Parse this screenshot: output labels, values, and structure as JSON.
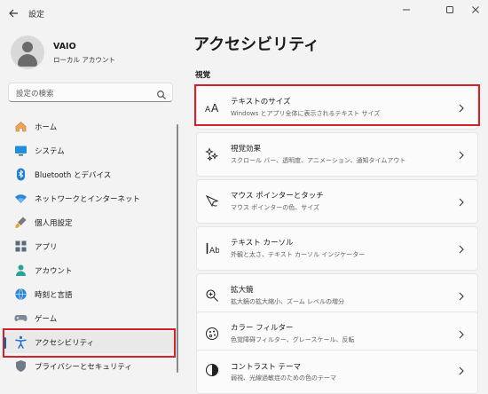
{
  "window": {
    "title": "設定",
    "back_icon": "back-arrow-icon",
    "controls": [
      "minimize-icon",
      "maximize-icon",
      "close-icon"
    ]
  },
  "profile": {
    "name": "VAIO",
    "account_type": "ローカル アカウント"
  },
  "search": {
    "placeholder": "設定の検索",
    "icon": "search-icon"
  },
  "sidebar": {
    "items": [
      {
        "label": "ホーム",
        "icon": "home-icon"
      },
      {
        "label": "システム",
        "icon": "system-display-icon"
      },
      {
        "label": "Bluetooth とデバイス",
        "icon": "bluetooth-icon"
      },
      {
        "label": "ネットワークとインターネット",
        "icon": "wifi-icon"
      },
      {
        "label": "個人用設定",
        "icon": "personalization-brush-icon"
      },
      {
        "label": "アプリ",
        "icon": "apps-icon"
      },
      {
        "label": "アカウント",
        "icon": "account-icon"
      },
      {
        "label": "時刻と言語",
        "icon": "time-language-icon"
      },
      {
        "label": "ゲーム",
        "icon": "gamepad-icon"
      },
      {
        "label": "アクセシビリティ",
        "icon": "accessibility-icon",
        "selected": true
      },
      {
        "label": "プライバシーとセキュリティ",
        "icon": "shield-icon"
      }
    ]
  },
  "main": {
    "title": "アクセシビリティ",
    "section": "視覚",
    "cards": [
      {
        "title": "テキストのサイズ",
        "subtitle": "Windows とアプリ全体に表示されるテキスト サイズ",
        "icon": "text-size-icon"
      },
      {
        "title": "視覚効果",
        "subtitle": "スクロール バー、透明度、アニメーション、通知タイムアウト",
        "icon": "visual-effects-icon"
      },
      {
        "title": "マウス ポインターとタッチ",
        "subtitle": "マウス ポインターの色、サイズ",
        "icon": "mouse-pointer-icon"
      },
      {
        "title": "テキスト カーソル",
        "subtitle": "外観と太さ、テキスト カーソル インジケーター",
        "icon": "text-cursor-icon"
      },
      {
        "title": "拡大鏡",
        "subtitle": "拡大鏡の拡大縮小、ズーム レベルの増分",
        "icon": "magnifier-icon"
      },
      {
        "title": "カラー フィルター",
        "subtitle": "色覚障碍フィルター、グレースケール、反転",
        "icon": "color-filter-icon"
      },
      {
        "title": "コントラスト テーマ",
        "subtitle": "弱視、光線過敏症のための色のテーマ",
        "icon": "contrast-theme-icon"
      }
    ]
  },
  "colors": {
    "accent": "#0067c0",
    "highlight": "#d32029"
  }
}
